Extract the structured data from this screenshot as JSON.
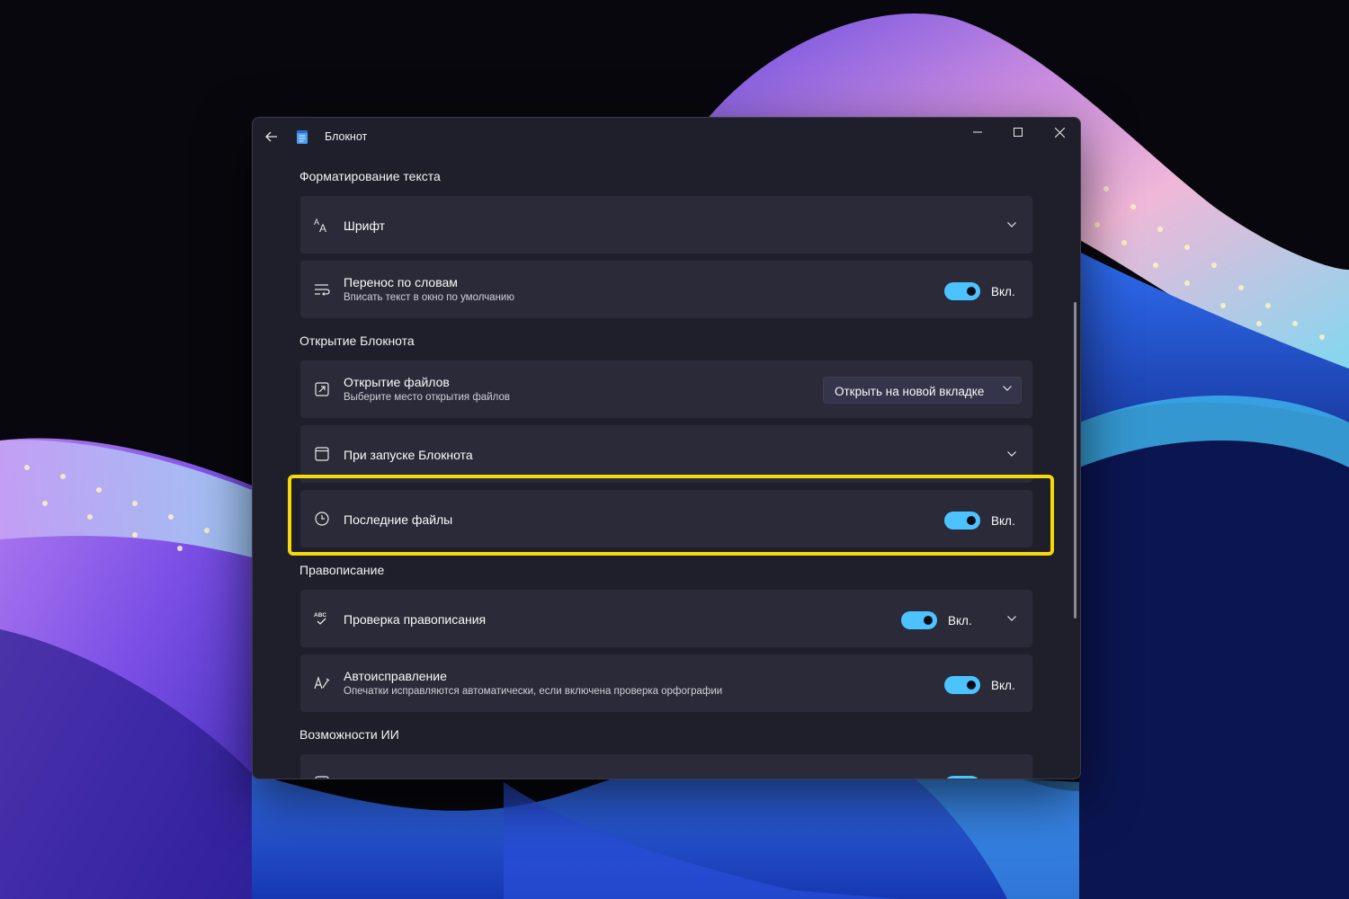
{
  "window": {
    "title": "Блокнот",
    "controls": {
      "minimize": "minimize",
      "maximize": "maximize",
      "close": "close"
    }
  },
  "sections": {
    "formatting": "Форматирование текста",
    "opening": "Открытие Блокнота",
    "spelling": "Правописание",
    "ai": "Возможности ИИ"
  },
  "settings": {
    "font": {
      "label": "Шрифт",
      "icon": "font-icon"
    },
    "wrap": {
      "label": "Перенос по словам",
      "desc": "Вписать текст в окно по умолчанию",
      "state": "Вкл.",
      "on": true,
      "icon": "word-wrap-icon"
    },
    "open_files": {
      "label": "Открытие файлов",
      "desc": "Выберите место открытия файлов",
      "value": "Открыть на новой вкладке",
      "icon": "open-file-icon"
    },
    "startup": {
      "label": "При запуске Блокнота",
      "icon": "window-icon"
    },
    "recent": {
      "label": "Последние файлы",
      "state": "Вкл.",
      "on": true,
      "icon": "clock-icon"
    },
    "spellcheck": {
      "label": "Проверка правописания",
      "state": "Вкл.",
      "on": true,
      "icon": "spellcheck-icon"
    },
    "autocorrect": {
      "label": "Автоисправление",
      "desc": "Опечатки исправляются автоматически, если включена проверка орфографии",
      "state": "Вкл.",
      "on": true,
      "icon": "autocorrect-icon"
    }
  },
  "colors": {
    "accent": "#4cc2ff",
    "highlight": "#f5d90a",
    "window_bg": "#1f1f2c",
    "card_bg": "#2a2a39"
  }
}
